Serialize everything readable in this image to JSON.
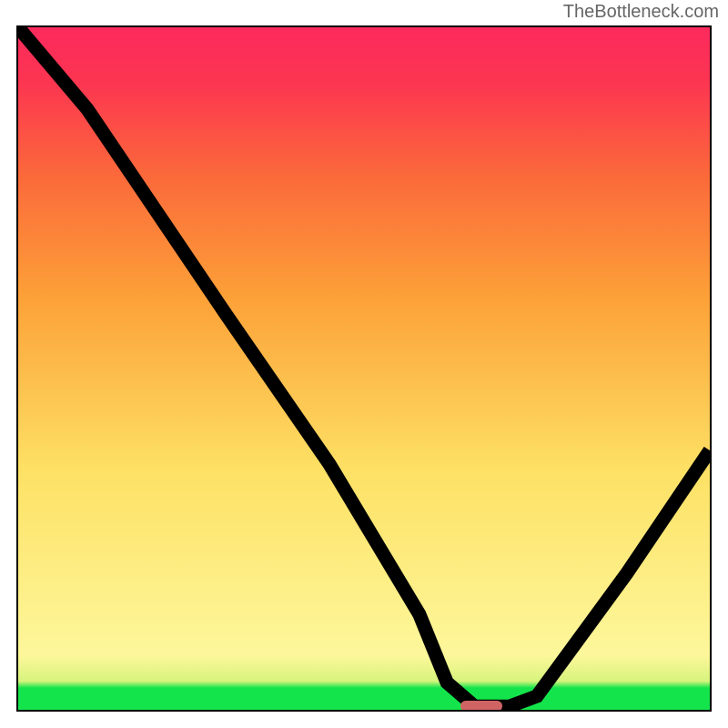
{
  "watermark": "TheBottleneck.com",
  "chart_data": {
    "type": "line",
    "title": "",
    "xlabel": "",
    "ylabel": "",
    "xlim": [
      0,
      100
    ],
    "ylim": [
      0,
      100
    ],
    "grid": false,
    "legend": false,
    "series": [
      {
        "name": "bottleneck-curve",
        "x": [
          0,
          10,
          18,
          30,
          45,
          58,
          62,
          66,
          71,
          75,
          88,
          100
        ],
        "values": [
          100,
          88,
          76,
          58,
          36,
          14,
          4,
          0.5,
          0.5,
          2,
          20,
          38
        ]
      }
    ],
    "annotations": [
      {
        "name": "optimal-range-marker",
        "x_start": 64,
        "x_end": 70,
        "y": 0.6,
        "color": "#d06464"
      }
    ],
    "background_gradient": {
      "stops": [
        {
          "pos": 0.0,
          "color": "#fc2a5d"
        },
        {
          "pos": 0.08,
          "color": "#fc3551"
        },
        {
          "pos": 0.22,
          "color": "#fb6a3a"
        },
        {
          "pos": 0.4,
          "color": "#fca238"
        },
        {
          "pos": 0.65,
          "color": "#fde165"
        },
        {
          "pos": 0.92,
          "color": "#fdf79b"
        },
        {
          "pos": 0.958,
          "color": "#d7f47d"
        },
        {
          "pos": 0.968,
          "color": "#14e44b"
        },
        {
          "pos": 1.0,
          "color": "#14e44b"
        }
      ],
      "direction": "top-to-bottom"
    }
  }
}
